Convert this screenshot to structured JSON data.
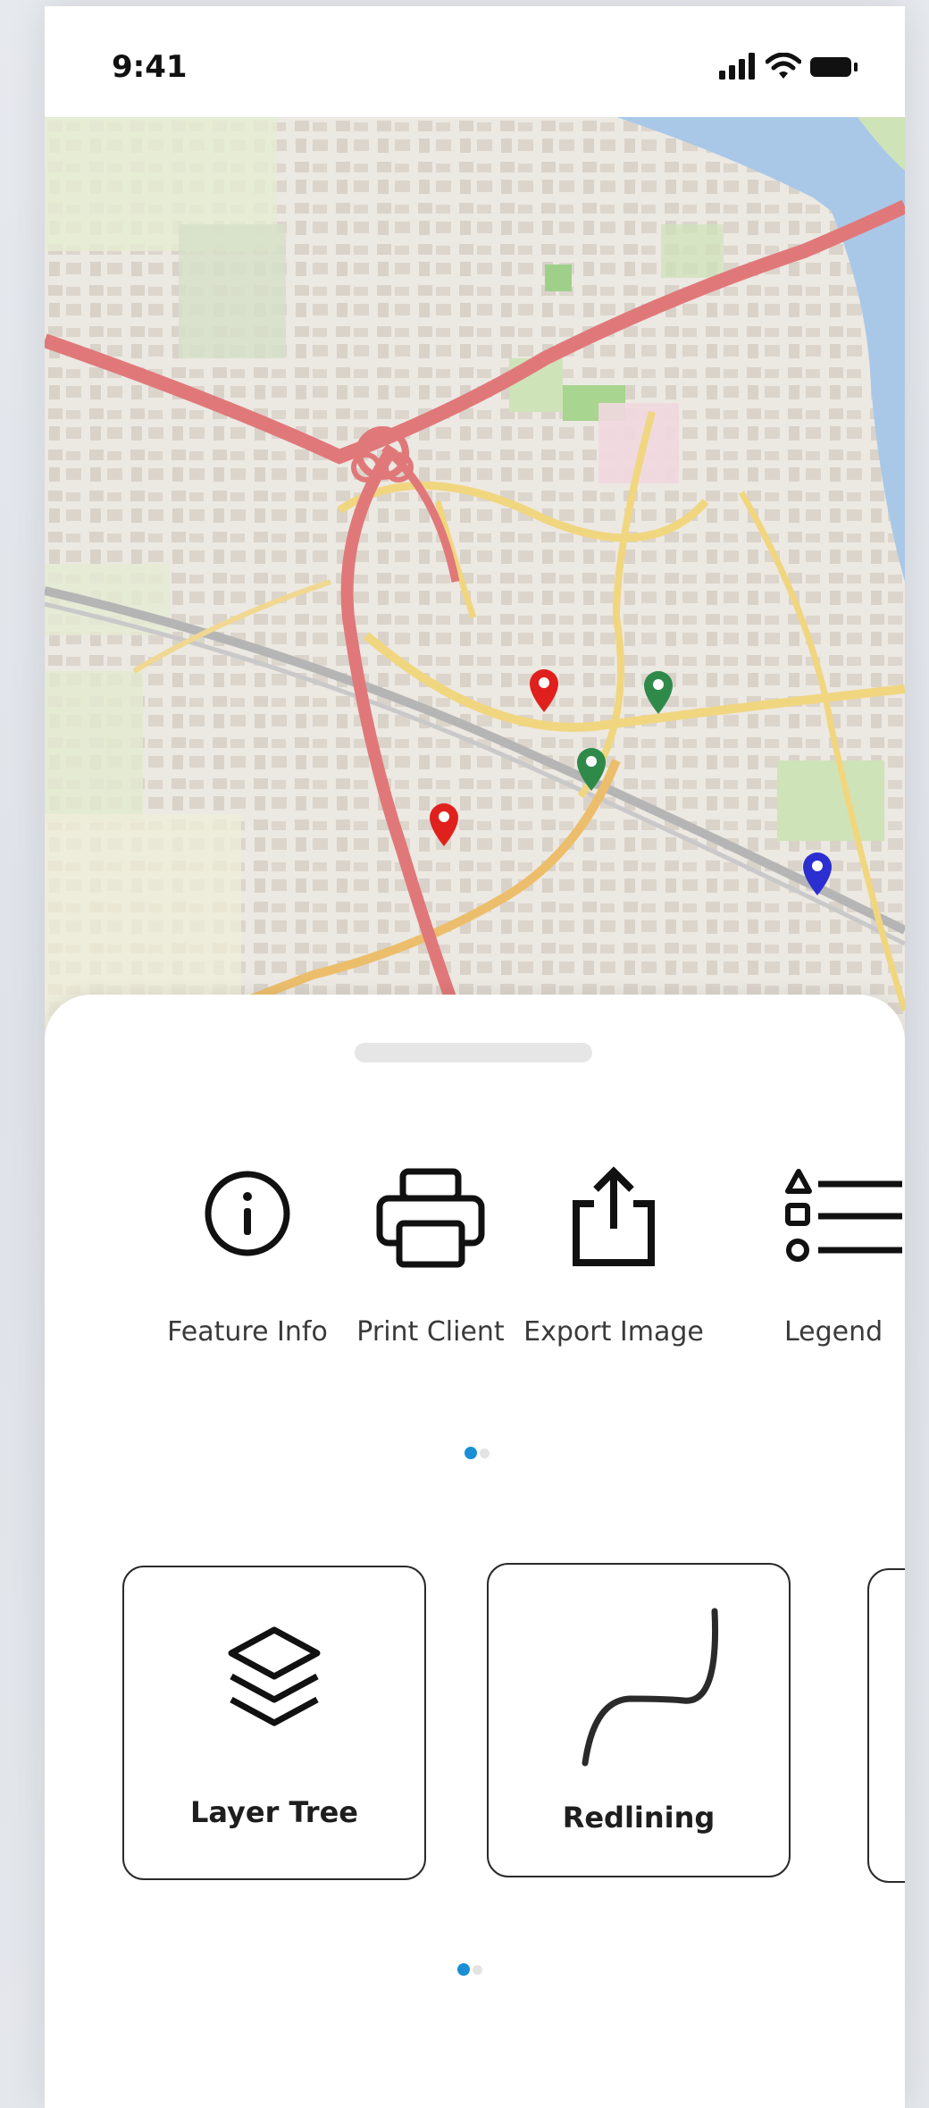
{
  "status_bar": {
    "time": "9:41",
    "icons": [
      "signal-icon",
      "wifi-icon",
      "battery-icon"
    ]
  },
  "map": {
    "markers": [
      {
        "color": "#e0201c",
        "icon": "map-pin-icon"
      },
      {
        "color": "#e0201c",
        "icon": "map-pin-icon"
      },
      {
        "color": "#2f8a4a",
        "icon": "map-pin-icon"
      },
      {
        "color": "#2f8a4a",
        "icon": "map-pin-icon"
      },
      {
        "color": "#2b2fd0",
        "icon": "map-pin-icon"
      }
    ]
  },
  "tools": [
    {
      "label": "Feature Info",
      "icon": "info-icon"
    },
    {
      "label": "Print Client",
      "icon": "printer-icon"
    },
    {
      "label": "Export Image",
      "icon": "share-icon"
    },
    {
      "label": "Legend",
      "icon": "legend-list-icon"
    }
  ],
  "tools_pager": {
    "page": 1,
    "pages": 2
  },
  "cards": [
    {
      "label": "Layer Tree",
      "icon": "layers-icon"
    },
    {
      "label": "Redlining",
      "icon": "freehand-line-icon"
    }
  ],
  "cards_pager": {
    "page": 1,
    "pages": 2
  },
  "colors": {
    "accent": "#1a8fd6",
    "highway": "#e0787a",
    "water": "#a9c8e8"
  }
}
